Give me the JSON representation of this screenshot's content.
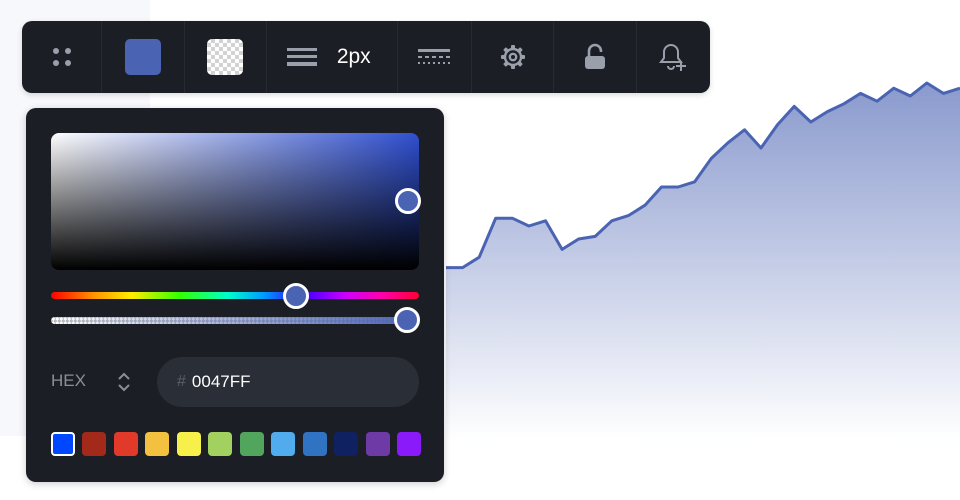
{
  "toolbar": {
    "drag_icon": "drag-handle-icon",
    "fill_color": "#4a63b2",
    "background_icon": "transparent-swatch",
    "line_width_label": "2px",
    "line_style_icon": "line-style-icon",
    "settings_icon": "gear-icon",
    "lock_icon": "unlocked-padlock-icon",
    "alert_icon": "bell-plus-icon"
  },
  "picker": {
    "format_label": "HEX",
    "hex_prefix": "#",
    "hex_value": "0047FF",
    "handle_color": "#4a63b2",
    "hue_position": 0.66,
    "alpha": 1.0,
    "swatches": [
      {
        "color": "#0047ff",
        "selected": true
      },
      {
        "color": "#a3291b",
        "selected": false
      },
      {
        "color": "#e23a2a",
        "selected": false
      },
      {
        "color": "#f4c03f",
        "selected": false
      },
      {
        "color": "#f7f04a",
        "selected": false
      },
      {
        "color": "#a3d160",
        "selected": false
      },
      {
        "color": "#52a55d",
        "selected": false
      },
      {
        "color": "#50acec",
        "selected": false
      },
      {
        "color": "#2f73c2",
        "selected": false
      },
      {
        "color": "#0f2160",
        "selected": false
      },
      {
        "color": "#6e3aa5",
        "selected": false
      },
      {
        "color": "#8a1af9",
        "selected": false
      }
    ]
  },
  "chart": {
    "line_color": "#4a63b2",
    "series": [
      0.24,
      0.24,
      0.28,
      0.43,
      0.43,
      0.4,
      0.42,
      0.31,
      0.35,
      0.36,
      0.42,
      0.44,
      0.48,
      0.55,
      0.55,
      0.57,
      0.66,
      0.72,
      0.77,
      0.7,
      0.79,
      0.86,
      0.8,
      0.84,
      0.87,
      0.91,
      0.88,
      0.93,
      0.9,
      0.95,
      0.91,
      0.93
    ]
  }
}
